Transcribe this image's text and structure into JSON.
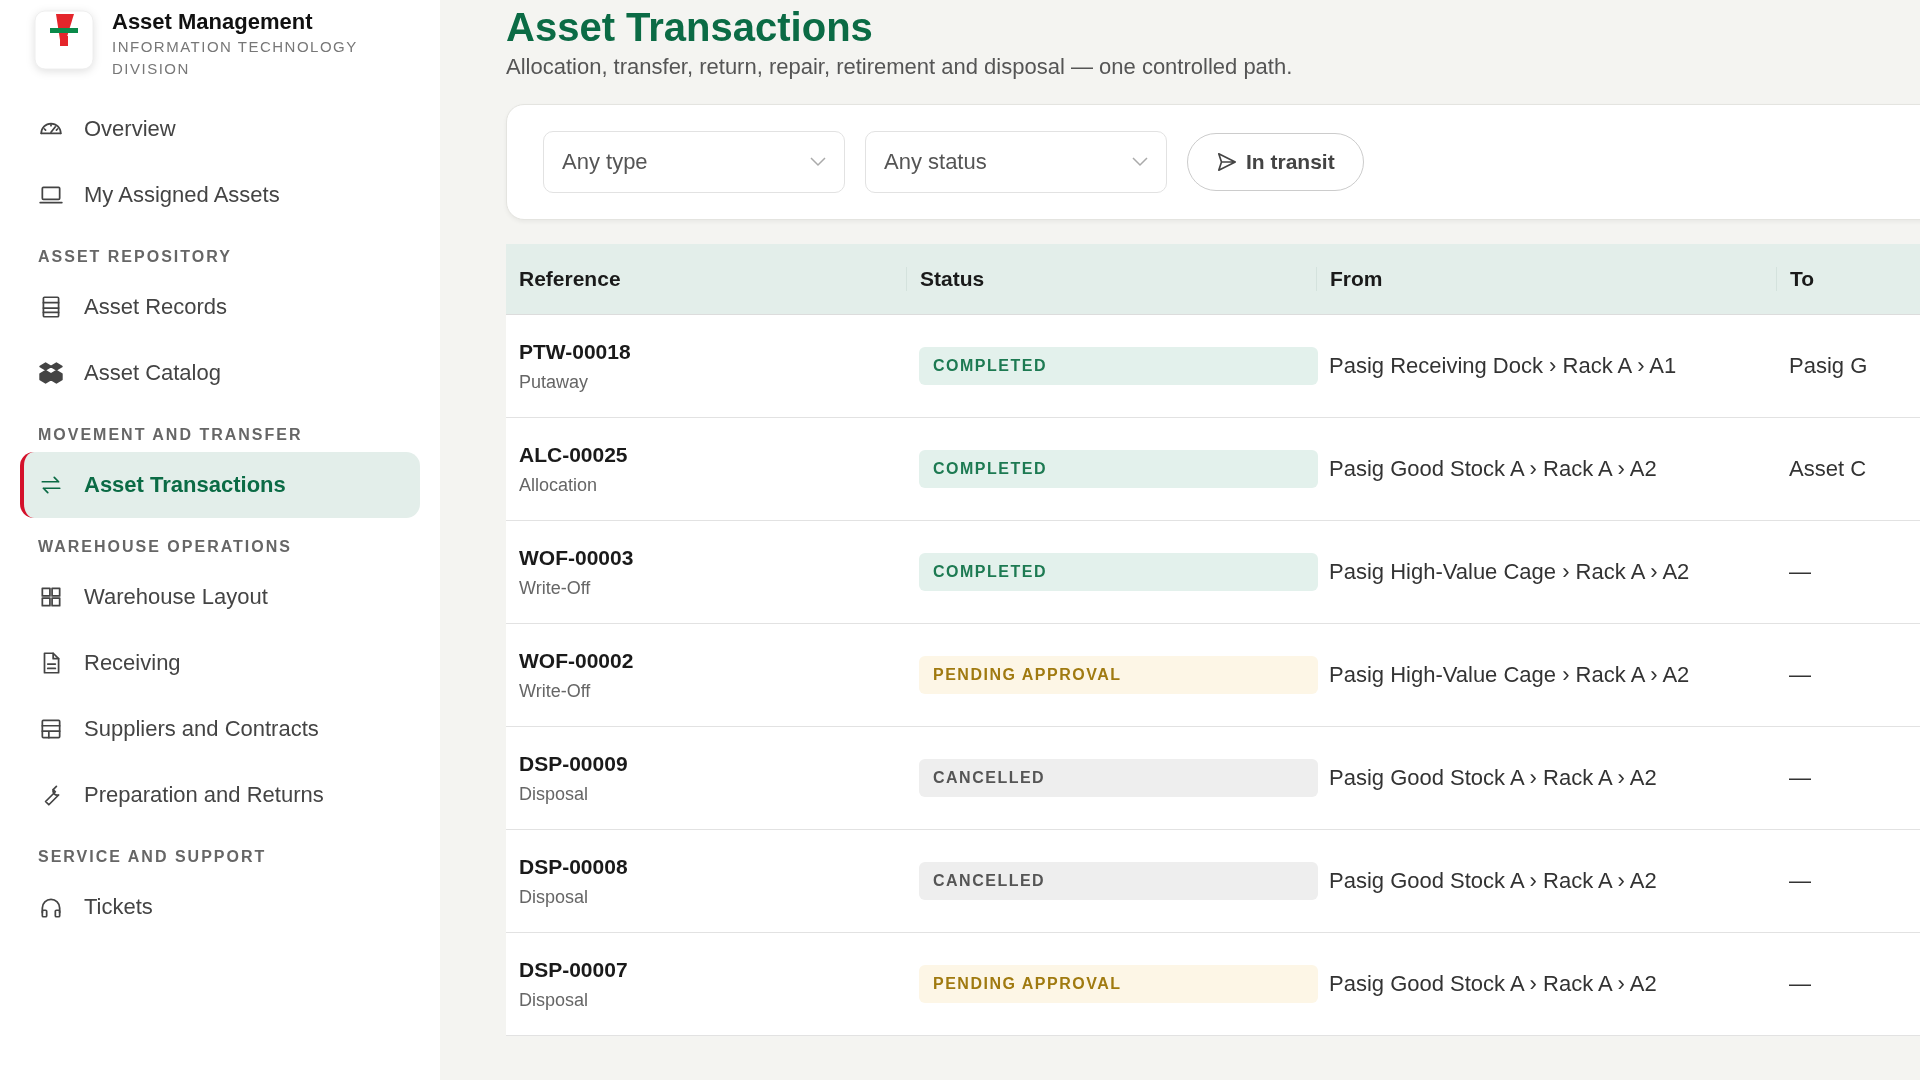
{
  "brand": {
    "title": "Asset Management",
    "subtitle": "INFORMATION TECHNOLOGY DIVISION"
  },
  "sidebar": {
    "sections": [
      {
        "items": [
          {
            "label": "Overview",
            "selected": false
          },
          {
            "label": "My Assigned Assets",
            "selected": false
          }
        ]
      },
      {
        "heading": "ASSET REPOSITORY",
        "items": [
          {
            "label": "Asset Records",
            "selected": false
          },
          {
            "label": "Asset Catalog",
            "selected": false
          }
        ]
      },
      {
        "heading": "MOVEMENT AND TRANSFER",
        "items": [
          {
            "label": "Asset Transactions",
            "selected": true
          }
        ]
      },
      {
        "heading": "WAREHOUSE OPERATIONS",
        "items": [
          {
            "label": "Warehouse Layout",
            "selected": false
          },
          {
            "label": "Receiving",
            "selected": false
          },
          {
            "label": "Suppliers and Contracts",
            "selected": false
          },
          {
            "label": "Preparation and Returns",
            "selected": false
          }
        ]
      },
      {
        "heading": "SERVICE AND SUPPORT",
        "items": [
          {
            "label": "Tickets",
            "selected": false
          }
        ]
      }
    ]
  },
  "page": {
    "title": "Asset Transactions",
    "subtitle": "Allocation, transfer, return, repair, retirement and disposal — one controlled path."
  },
  "filters": {
    "type": {
      "value": "Any type"
    },
    "status": {
      "value": "Any status"
    },
    "in_transit": {
      "label": "In transit",
      "selected": false
    }
  },
  "table": {
    "columns": [
      "Reference",
      "Status",
      "From",
      "To"
    ],
    "rows": [
      {
        "reference": "PTW-00018",
        "type": "Putaway",
        "status": {
          "label": "COMPLETED",
          "kind": "completed"
        },
        "from": "Pasig Receiving Dock › Rack A › A1",
        "to": "Pasig G"
      },
      {
        "reference": "ALC-00025",
        "type": "Allocation",
        "status": {
          "label": "COMPLETED",
          "kind": "completed"
        },
        "from": "Pasig Good Stock A › Rack A › A2",
        "to": "Asset C"
      },
      {
        "reference": "WOF-00003",
        "type": "Write-Off",
        "status": {
          "label": "COMPLETED",
          "kind": "completed"
        },
        "from": "Pasig High-Value Cage › Rack A › A2",
        "to": "—"
      },
      {
        "reference": "WOF-00002",
        "type": "Write-Off",
        "status": {
          "label": "PENDING APPROVAL",
          "kind": "pending"
        },
        "from": "Pasig High-Value Cage › Rack A › A2",
        "to": "—"
      },
      {
        "reference": "DSP-00009",
        "type": "Disposal",
        "status": {
          "label": "CANCELLED",
          "kind": "cancelled"
        },
        "from": "Pasig Good Stock A › Rack A › A2",
        "to": "—"
      },
      {
        "reference": "DSP-00008",
        "type": "Disposal",
        "status": {
          "label": "CANCELLED",
          "kind": "cancelled"
        },
        "from": "Pasig Good Stock A › Rack A › A2",
        "to": "—"
      },
      {
        "reference": "DSP-00007",
        "type": "Disposal",
        "status": {
          "label": "PENDING APPROVAL",
          "kind": "pending"
        },
        "from": "Pasig Good Stock A › Rack A › A2",
        "to": "—"
      }
    ]
  }
}
